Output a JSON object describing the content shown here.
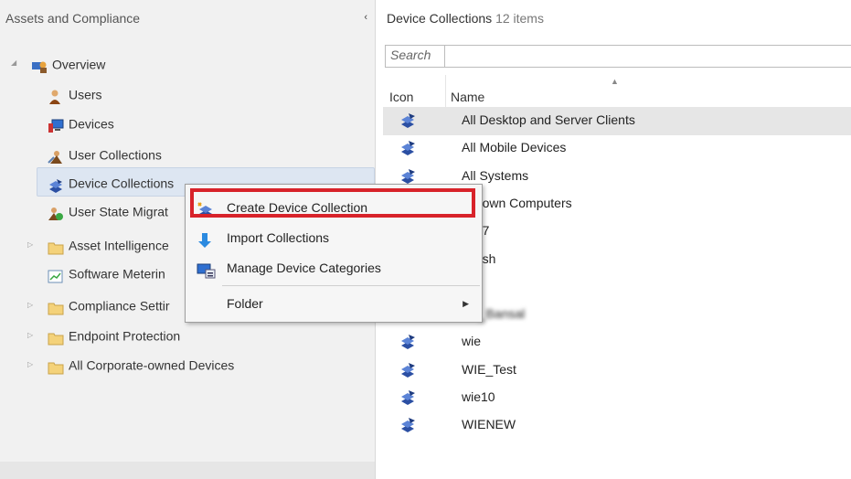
{
  "left_panel": {
    "title": "Assets and Compliance",
    "collapse_glyph": "‹",
    "tree": {
      "overview": "Overview",
      "users": "Users",
      "devices": "Devices",
      "user_collections": "User Collections",
      "device_collections": "Device Collections",
      "user_state_migration": "User State Migrat",
      "asset_intelligence": "Asset Intelligence",
      "software_metering": "Software Meterin",
      "compliance_settings": "Compliance Settir",
      "endpoint_protection": "Endpoint Protection",
      "all_corporate_owned": "All Corporate-owned Devices"
    }
  },
  "right_panel": {
    "title": "Device Collections",
    "count": "12 items",
    "search_placeholder": "Search",
    "columns": {
      "icon": "Icon",
      "name": "Name"
    },
    "rows": [
      "All Desktop and Server Clients",
      "All Mobile Devices",
      "All Systems",
      "nknown Computers",
      "oy27",
      "spush",
      "",
      "ien_Bansal",
      "wie",
      "WIE_Test",
      "wie10",
      "WIENEW"
    ]
  },
  "context_menu": {
    "items": [
      {
        "label": "Create Device Collection",
        "icon": "create-collection-icon"
      },
      {
        "label": "Import Collections",
        "icon": "import-arrow-icon"
      },
      {
        "label": "Manage Device Categories",
        "icon": "device-categories-icon"
      },
      {
        "label": "Folder",
        "icon": ""
      }
    ],
    "submenu_glyph": "▶"
  },
  "colors": {
    "highlight_border": "#d8232a",
    "selection": "#dde6f2"
  }
}
